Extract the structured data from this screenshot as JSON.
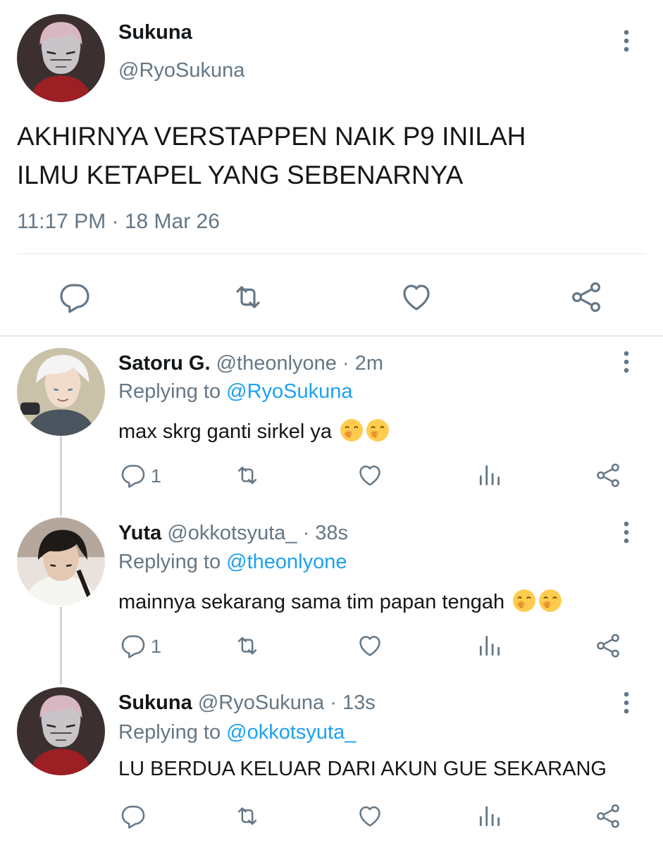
{
  "main_tweet": {
    "author_name": "Sukuna",
    "author_handle": "@RyoSukuna",
    "text_line1": "AKHIRNYA VERSTAPPEN NAIK P9 INILAH",
    "text_line2": "ILMU KETAPEL YANG SEBENARNYA",
    "timestamp": "11:17 PM · 18 Mar 26",
    "actions": [
      "reply-icon",
      "retweet-icon",
      "like-icon",
      "share-icon"
    ]
  },
  "replies": [
    {
      "name": "Satoru G.",
      "handle_time": "@theonlyone · 2m",
      "replying_prefix": "Replying to",
      "replying_to": "@RyoSukuna",
      "text": "max skrg ganti sirkel ya",
      "emoji_count": 2,
      "reply_count": "1"
    },
    {
      "name": "Yuta",
      "handle_time": "@okkotsyuta_ · 38s",
      "replying_prefix": "Replying to",
      "replying_to": "@theonlyone",
      "text": "mainnya sekarang sama tim papan tengah",
      "emoji_count": 2,
      "reply_count": "1"
    },
    {
      "name": "Sukuna",
      "handle_time": "@RyoSukuna · 13s",
      "replying_prefix": "Replying to",
      "replying_to": "@okkotsyuta_",
      "text": "LU BERDUA KELUAR DARI AKUN GUE SEKARANG",
      "emoji_count": 0,
      "reply_count": ""
    }
  ],
  "colors": {
    "link": "#1da1f2",
    "secondary_text": "#657786",
    "divider": "#e1e8ed"
  }
}
